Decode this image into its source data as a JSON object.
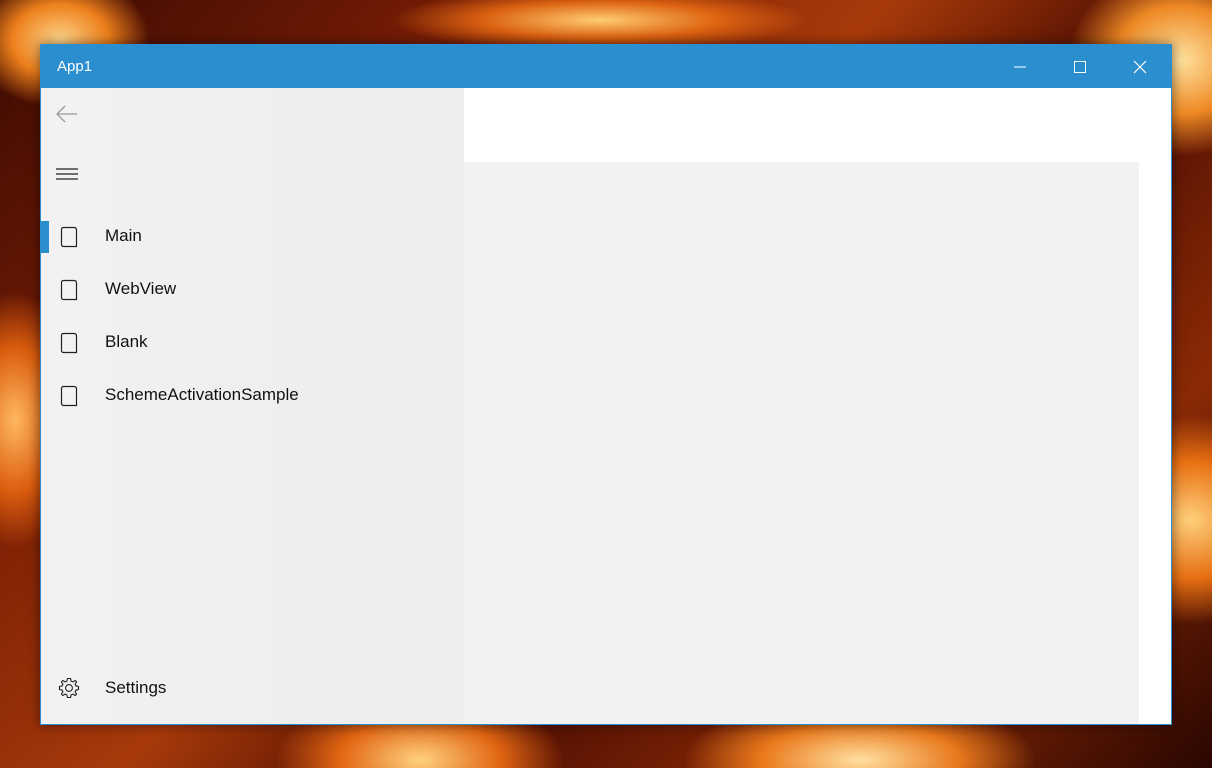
{
  "window": {
    "title": "App1"
  },
  "nav": {
    "items": [
      {
        "label": "Main",
        "icon": "page-icon",
        "selected": true
      },
      {
        "label": "WebView",
        "icon": "page-icon",
        "selected": false
      },
      {
        "label": "Blank",
        "icon": "page-icon",
        "selected": false
      },
      {
        "label": "SchemeActivationSample",
        "icon": "page-icon",
        "selected": false
      }
    ],
    "settings_label": "Settings"
  },
  "colors": {
    "accent": "#2b8fcf",
    "pane_bg": "#f2f2f2",
    "content_bg": "#f2f2f2"
  }
}
